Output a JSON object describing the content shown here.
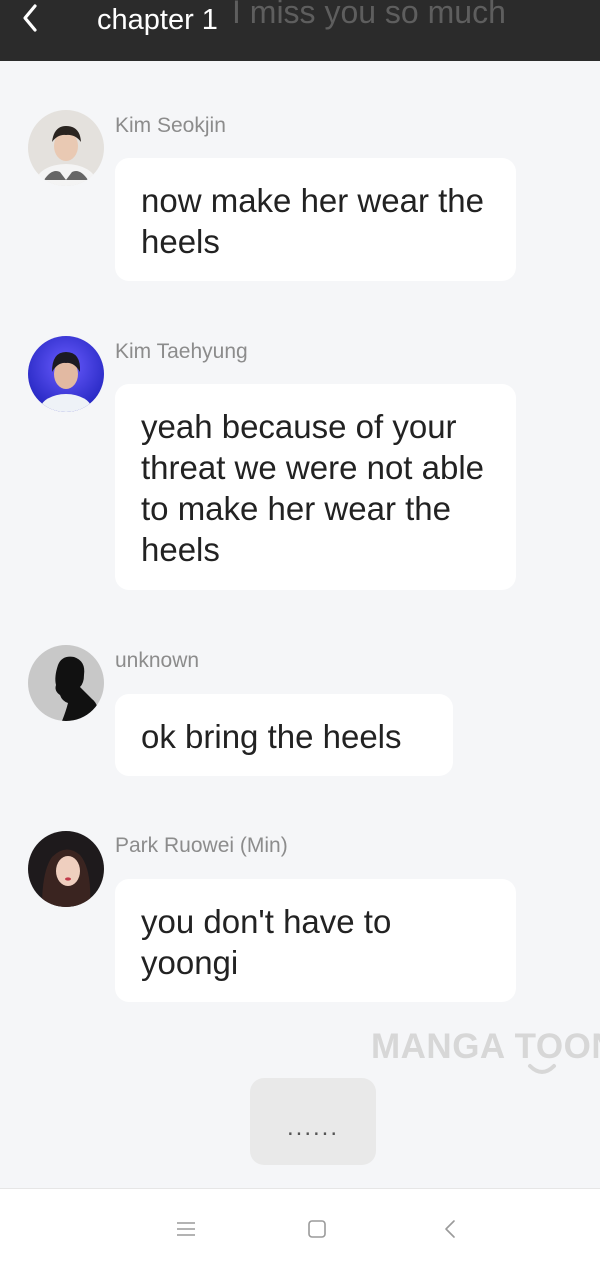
{
  "header": {
    "title": "chapter 1",
    "background_text": "I miss you so much",
    "back_icon": "chevron-left-icon"
  },
  "messages": [
    {
      "sender": "Kim Seokjin",
      "text": "now make her wear the heels"
    },
    {
      "sender": "Kim Taehyung",
      "text": "yeah because of your threat we were not able to make her wear the heels"
    },
    {
      "sender": "unknown",
      "text": "ok bring the heels"
    },
    {
      "sender": "Park Ruowei (Min)",
      "text": "you don't have to yoongi"
    }
  ],
  "watermark": "MANGA TOON",
  "more_button": "......",
  "system_nav": {
    "menu_icon": "menu-icon",
    "home_icon": "square-home-icon",
    "back_icon": "back-icon"
  },
  "colors": {
    "header_bg": "#2b2b2b",
    "page_bg": "#f5f6f8",
    "bubble_bg": "#ffffff",
    "name_text": "#8c8c8c"
  }
}
